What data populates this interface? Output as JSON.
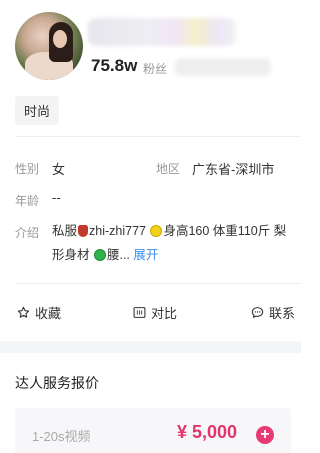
{
  "profile": {
    "fans_count": "75.8w",
    "fans_label": "粉丝"
  },
  "tags": [
    "时尚"
  ],
  "details": {
    "gender_label": "性别",
    "gender_value": "女",
    "region_label": "地区",
    "region_value": "广东省-深圳市",
    "age_label": "年龄",
    "age_value": "--",
    "intro_label": "介绍",
    "intro_part1": "私服",
    "intro_part2": "zhi-zhi777 ",
    "intro_part3": "身高160 体重110斤 梨形身材 ",
    "intro_part4": "腰...",
    "intro_expand": "展开"
  },
  "actions": {
    "collect": "收藏",
    "compare": "对比",
    "contact": "联系"
  },
  "services": {
    "title": "达人服务报价",
    "items": [
      {
        "label": "1-20s视频",
        "price": "¥ 5,000"
      }
    ]
  },
  "icons": {
    "collect": "star-icon",
    "compare": "compare-icon",
    "contact": "chat-icon",
    "add": "plus-icon"
  },
  "colors": {
    "price": "#e5336c",
    "link": "#3c8ee7",
    "add_button": "#e83a72"
  }
}
